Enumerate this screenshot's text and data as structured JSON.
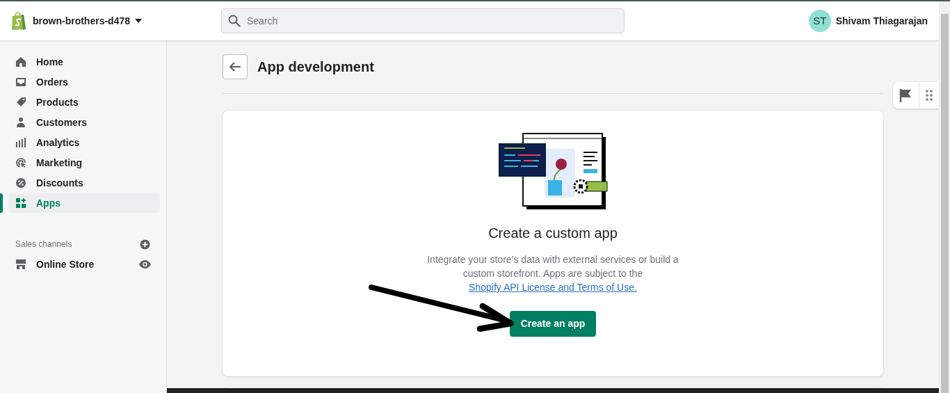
{
  "store": {
    "name": "brown-brothers-d478"
  },
  "search": {
    "placeholder": "Search"
  },
  "user": {
    "initials": "ST",
    "name": "Shivam Thiagarajan"
  },
  "nav": [
    {
      "label": "Home",
      "selected": false
    },
    {
      "label": "Orders",
      "selected": false
    },
    {
      "label": "Products",
      "selected": false
    },
    {
      "label": "Customers",
      "selected": false
    },
    {
      "label": "Analytics",
      "selected": false
    },
    {
      "label": "Marketing",
      "selected": false
    },
    {
      "label": "Discounts",
      "selected": false
    },
    {
      "label": "Apps",
      "selected": true
    }
  ],
  "sales_channels": {
    "label": "Sales channels",
    "items": [
      {
        "label": "Online Store"
      }
    ]
  },
  "page": {
    "title": "App development"
  },
  "card": {
    "heading": "Create a custom app",
    "description": "Integrate your store’s data with external services or build a custom storefront. Apps are subject to the",
    "link": "Shopify API License and Terms of Use.",
    "button": "Create an app"
  }
}
